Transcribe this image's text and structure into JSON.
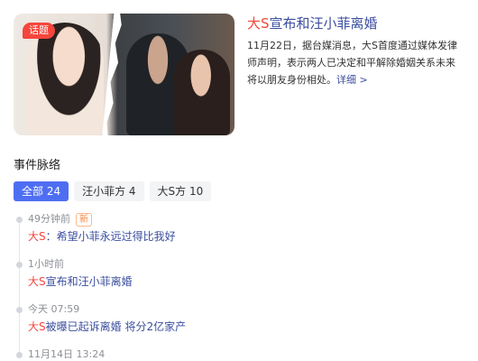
{
  "top_story": {
    "badge": "话题",
    "headline_highlight": "大S",
    "headline_rest": "宣布和汪小菲离婚",
    "summary": "11月22日，据台媒消息，大S首度通过媒体发律师声明，表示两人已决定和平解除婚姻关系未来将以朋友身份相处。",
    "more_label": "详细 >"
  },
  "section_title": "事件脉络",
  "filters": [
    {
      "label": "全部 24",
      "active": true
    },
    {
      "label": "汪小菲方 4",
      "active": false
    },
    {
      "label": "大S方 10",
      "active": false
    }
  ],
  "timeline": [
    {
      "time": "49分钟前",
      "tag": "新",
      "title_highlight": "大S",
      "title_rest": "：希望小菲永远过得比我好"
    },
    {
      "time": "1小时前",
      "tag": "",
      "title_highlight": "大S",
      "title_rest": "宣布和汪小菲离婚"
    },
    {
      "time": "今天 07:59",
      "tag": "",
      "title_highlight": "大S",
      "title_rest": "被曝已起诉离婚 将分2亿家产"
    },
    {
      "time": "11月14日 13:24",
      "tag": "",
      "title_highlight": "",
      "title_rest": ""
    }
  ],
  "colors": {
    "accent_red": "#f5463c",
    "link_blue": "#3b4e9e",
    "tab_active": "#4e6ef2"
  }
}
